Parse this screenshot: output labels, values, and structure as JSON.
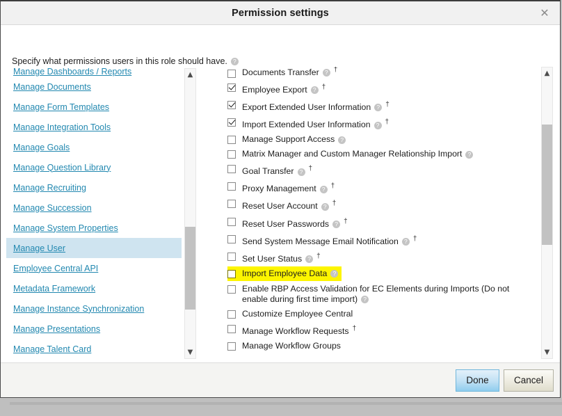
{
  "dialog": {
    "title": "Permission settings",
    "close_icon": "close-icon",
    "instruction": "Specify what permissions users in this role should have.",
    "instruction_help_icon": "help-icon"
  },
  "sidebar": {
    "items": [
      {
        "label": "Manage Dashboards / Reports",
        "selected": false,
        "clipped": true
      },
      {
        "label": "Manage Documents",
        "selected": false
      },
      {
        "label": "Manage Form Templates",
        "selected": false
      },
      {
        "label": "Manage Integration Tools",
        "selected": false
      },
      {
        "label": "Manage Goals",
        "selected": false
      },
      {
        "label": "Manage Question Library",
        "selected": false
      },
      {
        "label": "Manage Recruiting",
        "selected": false
      },
      {
        "label": "Manage Succession",
        "selected": false
      },
      {
        "label": "Manage System Properties",
        "selected": false
      },
      {
        "label": "Manage User",
        "selected": true
      },
      {
        "label": "Employee Central API",
        "selected": false
      },
      {
        "label": "Metadata Framework",
        "selected": false
      },
      {
        "label": "Manage Instance Synchronization",
        "selected": false
      },
      {
        "label": "Manage Presentations",
        "selected": false
      },
      {
        "label": "Manage Talent Card",
        "selected": false
      }
    ],
    "scrollbar": {
      "up_arrow_icon": "chevron-up-icon",
      "down_arrow_icon": "chevron-down-icon",
      "thumb_top_pct": 55,
      "thumb_height_pct": 31
    }
  },
  "permissions": {
    "items": [
      {
        "label": "Documents Transfer",
        "checked": false,
        "help": true,
        "dagger": true,
        "clipped_top": true
      },
      {
        "label": "Employee Export",
        "checked": true,
        "help": true,
        "dagger": true
      },
      {
        "label": "Export Extended User Information",
        "checked": true,
        "help": true,
        "dagger": true
      },
      {
        "label": "Import Extended User Information",
        "checked": true,
        "help": true,
        "dagger": true
      },
      {
        "label": "Manage Support Access",
        "checked": false,
        "help": true,
        "dagger": false
      },
      {
        "label": "Matrix Manager and Custom Manager Relationship Import",
        "checked": false,
        "help": true,
        "dagger": false
      },
      {
        "label": "Goal Transfer",
        "checked": false,
        "help": true,
        "dagger": true
      },
      {
        "label": "Proxy Management",
        "checked": false,
        "help": true,
        "dagger": true
      },
      {
        "label": "Reset User Account",
        "checked": false,
        "help": true,
        "dagger": true
      },
      {
        "label": "Reset User Passwords",
        "checked": false,
        "help": true,
        "dagger": true
      },
      {
        "label": "Send System Message Email Notification",
        "checked": false,
        "help": true,
        "dagger": true
      },
      {
        "label": "Set User Status",
        "checked": false,
        "help": true,
        "dagger": true
      },
      {
        "label": "Import Employee Data",
        "checked": false,
        "help": true,
        "dagger": false,
        "highlight": true
      },
      {
        "label": "Enable RBP Access Validation for EC Elements during Imports (Do not enable during first time import)",
        "checked": false,
        "help": true,
        "dagger": false,
        "wrap": true
      },
      {
        "label": "Customize Employee Central",
        "checked": false,
        "help": false,
        "dagger": false
      },
      {
        "label": "Manage Workflow Requests",
        "checked": false,
        "help": false,
        "dagger": true
      },
      {
        "label": "Manage Workflow Groups",
        "checked": false,
        "help": false,
        "dagger": false,
        "clipped_bottom": true
      }
    ],
    "highlight_color": "#fdf500",
    "scrollbar": {
      "up_arrow_icon": "chevron-up-icon",
      "down_arrow_icon": "chevron-down-icon",
      "thumb_top_pct": 17,
      "thumb_height_pct": 45
    }
  },
  "footer": {
    "done_label": "Done",
    "cancel_label": "Cancel"
  }
}
